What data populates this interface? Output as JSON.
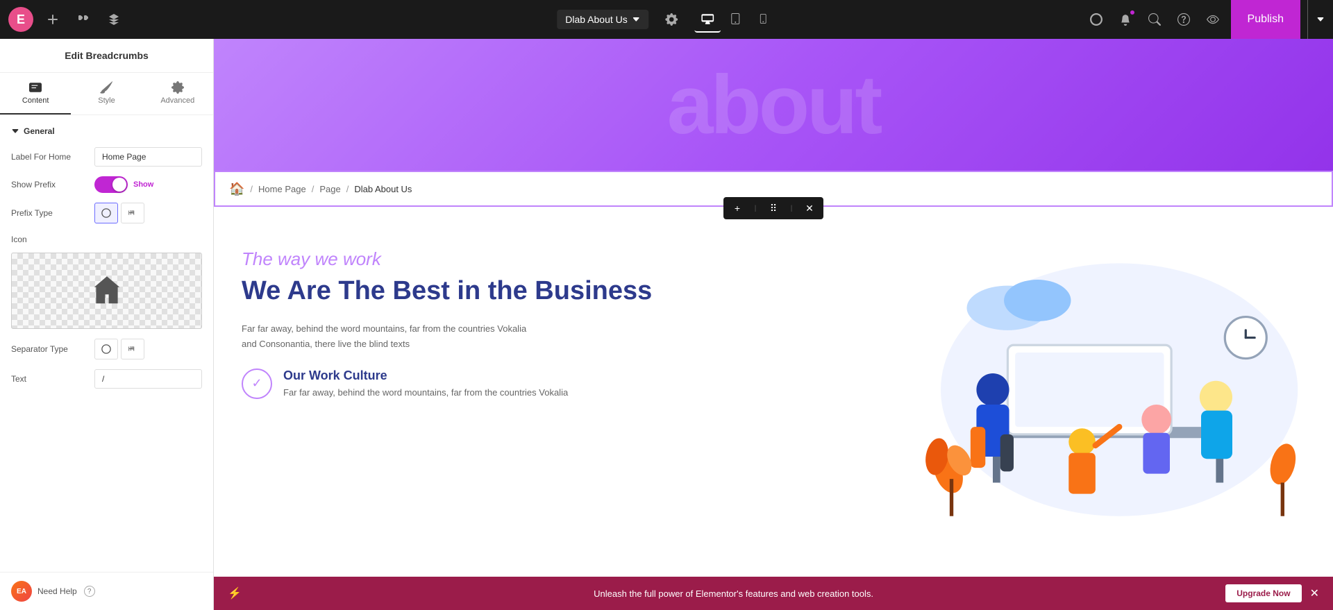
{
  "topbar": {
    "logo_letter": "E",
    "page_title": "Dlab About Us",
    "publish_label": "Publish",
    "tabs": {
      "desktop": "Desktop",
      "tablet": "Tablet",
      "mobile": "Mobile"
    }
  },
  "sidebar": {
    "title": "Edit Breadcrumbs",
    "tabs": [
      {
        "id": "content",
        "label": "Content"
      },
      {
        "id": "style",
        "label": "Style"
      },
      {
        "id": "advanced",
        "label": "Advanced"
      }
    ],
    "sections": {
      "general": {
        "label": "General",
        "fields": {
          "label_for_home": {
            "label": "Label For Home",
            "value": "Home Page"
          },
          "show_prefix": {
            "label": "Show Prefix",
            "toggle_label": "Show",
            "enabled": true
          },
          "prefix_type": {
            "label": "Prefix Type",
            "options": [
              "icon",
              "text"
            ]
          },
          "icon": {
            "label": "Icon"
          },
          "separator_type": {
            "label": "Separator Type",
            "options": [
              "icon",
              "text"
            ]
          },
          "text": {
            "label": "Text",
            "value": "/"
          }
        }
      }
    },
    "footer": {
      "avatar_initials": "EA",
      "need_help_label": "Need Help"
    }
  },
  "breadcrumb": {
    "home_icon": "🏠",
    "items": [
      "Home Page",
      "Page",
      "Dlab About Us"
    ],
    "separator": "/"
  },
  "content": {
    "the_way": "The way we work",
    "heading": "We Are The Best in the Business",
    "body": "Far far away, behind the word mountains, far from the countries Vokalia and Consonantia, there live the blind texts",
    "culture": {
      "title": "Our Work Culture",
      "text": "Far far away, behind the word mountains, far from the countries Vokalia"
    }
  },
  "bottom_bar": {
    "message": "Unleash the full power of Elementor's features and web creation tools.",
    "upgrade_label": "Upgrade Now"
  }
}
